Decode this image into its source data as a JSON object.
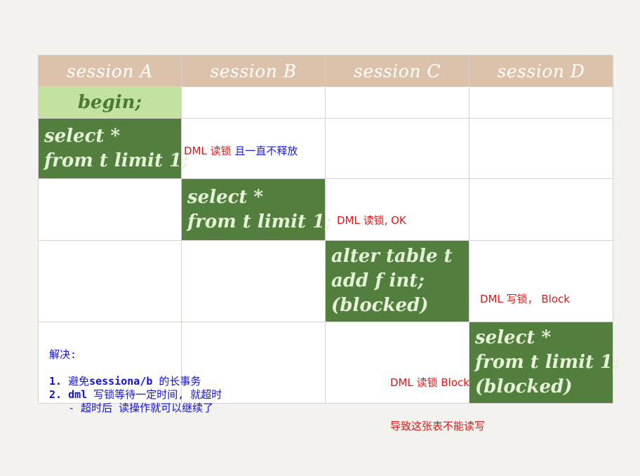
{
  "table": {
    "headers": [
      "session A",
      "session B",
      "session C",
      "session D"
    ],
    "cells": {
      "a_begin": "begin;",
      "a_select": [
        "select *",
        "from t limit 1;"
      ],
      "b_select": [
        "select *",
        "from t limit 1;"
      ],
      "c_alter": [
        "alter table t",
        "add f int;",
        "(blocked)"
      ],
      "d_select": [
        "select *",
        "from t limit 1;",
        "(blocked)"
      ]
    },
    "colors": {
      "header_bg": "#dcc2ab",
      "dark_green": "#527f3d",
      "light_green": "#c3e19f",
      "note_red": "#e01414",
      "note_blue": "#1a1ae0"
    }
  },
  "notes": {
    "b_row2_red": "DML 读锁",
    "b_row2_blue": " 且一直不释放",
    "c_row3": "DML 读锁, OK",
    "d_row4": "DML 写锁，  Block",
    "c_row5": "DML 读锁 Block",
    "c_below": "导致这张表不能读写"
  },
  "solution": {
    "title": "解决:",
    "item1_num": "1.",
    "item1_pre": " 避免",
    "item1_bold": "sessiona/b",
    "item1_post": " 的长事务",
    "item2_num": "2.",
    "item2_bold": " dml",
    "item2_post": " 写锁等待一定时间, 就超时",
    "item2_sub": "   - 超时后 读操作就可以继续了"
  }
}
